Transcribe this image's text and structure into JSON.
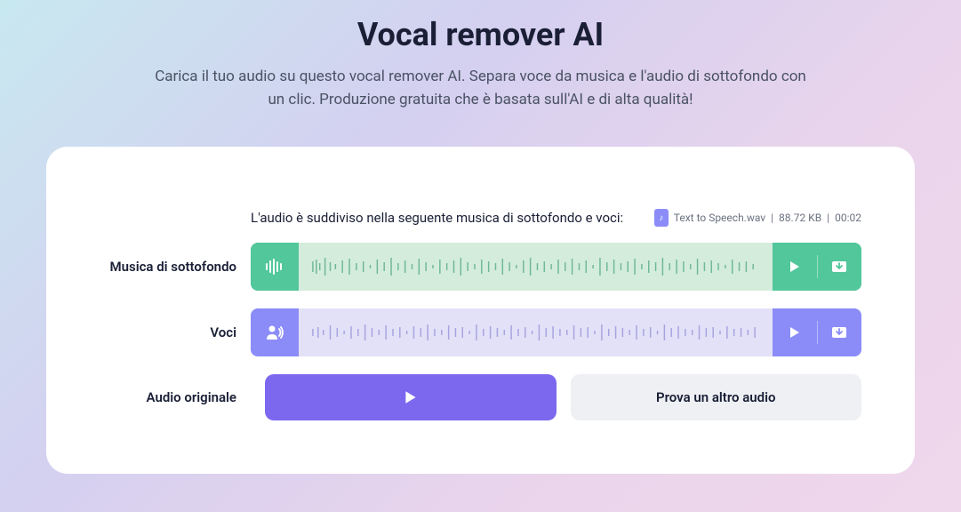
{
  "header": {
    "title": "Vocal remover AI",
    "subtitle": "Carica il tuo audio su questo vocal remover AI. Separa voce da musica e l'audio di sottofondo con un clic. Produzione gratuita che è basata sull'AI e di alta qualità!"
  },
  "split_text": "L'audio è suddiviso nella seguente musica di sottofondo e voci:",
  "file": {
    "name": "Text to Speech.wav",
    "size": "88.72 KB",
    "duration": "00:02"
  },
  "tracks": {
    "music": {
      "label": "Musica di sottofondo"
    },
    "vocals": {
      "label": "Voci"
    }
  },
  "bottom": {
    "original_label": "Audio originale",
    "try_another": "Prova un altro audio"
  },
  "colors": {
    "green": "#52c79b",
    "purple": "#8b8cf7",
    "primary": "#7b68ee"
  }
}
